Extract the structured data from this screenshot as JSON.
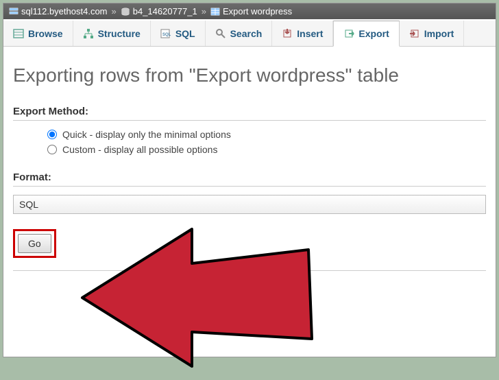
{
  "breadcrumb": {
    "server": "sql112.byethost4.com",
    "database": "b4_14620777_1",
    "table": "Export wordpress"
  },
  "tabs": {
    "browse": "Browse",
    "structure": "Structure",
    "sql": "SQL",
    "search": "Search",
    "insert": "Insert",
    "export": "Export",
    "import": "Import"
  },
  "heading": "Exporting rows from \"Export wordpress\" table",
  "export_method": {
    "label": "Export Method:",
    "quick": "Quick - display only the minimal options",
    "custom": "Custom - display all possible options",
    "selected": "quick"
  },
  "format": {
    "label": "Format:",
    "value": "SQL"
  },
  "go_label": "Go"
}
